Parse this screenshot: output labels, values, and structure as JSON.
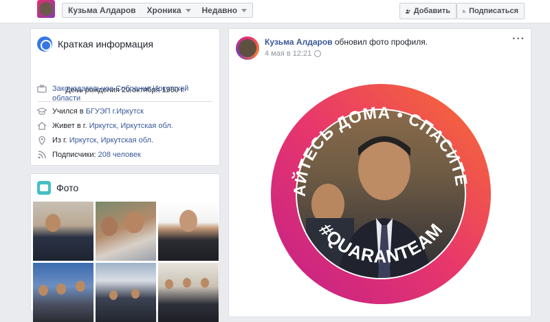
{
  "topbar": {
    "name": "Кузьма Алдаров",
    "timeline_label": "Хроника",
    "recent_label": "Недавно",
    "add_label": "Добавить",
    "subscribe_label": "Подписаться"
  },
  "intro": {
    "title": "Краткая информация",
    "birthday": "День рождения 20 октября 1960 г.",
    "work": "Законодательное Собрание Иркутской области",
    "study_prefix": "Учился в ",
    "study_link": "БГУЭП г.Иркутск",
    "lives_prefix": "Живет в г. ",
    "lives_link": "Иркутск, Иркутская обл.",
    "from_prefix": "Из г. ",
    "from_link": "Иркутск, Иркутская обл.",
    "followers_prefix": "Подписчики: ",
    "followers_link": "208 человек"
  },
  "photos": {
    "title": "Фото"
  },
  "post": {
    "author": "Кузьма Алдаров",
    "action": " обновил фото профиля.",
    "time": "4 мая в 12:21",
    "menu": "···",
    "frame_text_top": "ОСТАВАЙТЕСЬ ДОМА • СПАСИТЕ ЖИЗНИ",
    "frame_text_bottom": "#QUARANTEAM"
  },
  "icons": [
    "globe-icon",
    "briefcase-icon",
    "graduation-cap-icon",
    "home-icon",
    "location-pin-icon",
    "rss-icon",
    "photo-icon",
    "user-add-icon",
    "rss-icon",
    "chevron-down-icon"
  ],
  "colors": {
    "link": "#385898",
    "accent": "#3578e5",
    "frame_start": "#e1306c",
    "frame_end": "#f77737"
  }
}
